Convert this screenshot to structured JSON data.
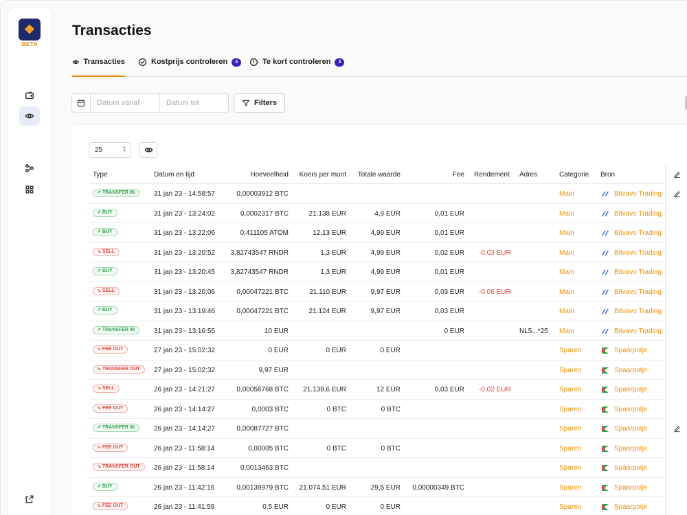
{
  "sidebar": {
    "logo_icon": "lion-logo-icon",
    "beta_label": "BETA",
    "items": [
      "wallet-icon",
      "transactions-eye-icon",
      "nodes-icon",
      "grid-icon",
      "external-link-icon"
    ]
  },
  "page": {
    "title": "Transacties"
  },
  "tabs": [
    {
      "label": "Transacties",
      "icon": "eye-transfer-icon",
      "badge": ""
    },
    {
      "label": "Kostprijs controleren",
      "icon": "check-circle-icon",
      "badge": "4"
    },
    {
      "label": "Te kort controleren",
      "icon": "alert-circle-icon",
      "badge": "3"
    }
  ],
  "filters": {
    "date_from_placeholder": "Datum vanaf",
    "date_to_placeholder": "Datum tot",
    "filters_label": "Filters"
  },
  "table": {
    "page_size": "25",
    "columns": [
      "Type",
      "Datum en tijd",
      "Hoeveelheid",
      "Koers per munt",
      "Totale waarde",
      "Fee",
      "Rendement",
      "Adres",
      "Categorie",
      "Bron"
    ],
    "rows": [
      {
        "type": "TRANSFER IN",
        "dir": "in",
        "date": "31 jan 23 - 14:58:57",
        "qty": "0,00003912 BTC",
        "rate": "",
        "total": "",
        "fee": "",
        "rend": "",
        "addr": "",
        "cat": "Main",
        "src": "Bitvavo Trading",
        "edit": true
      },
      {
        "type": "BUY",
        "dir": "in",
        "date": "31 jan 23 - 13:24:02",
        "qty": "0,0002317 BTC",
        "rate": "21.138 EUR",
        "total": "4,9 EUR",
        "fee": "0,01 EUR",
        "rend": "",
        "addr": "",
        "cat": "Main",
        "src": "Bitvavo Trading",
        "edit": false
      },
      {
        "type": "BUY",
        "dir": "in",
        "date": "31 jan 23 - 13:22:06",
        "qty": "0,411105 ATOM",
        "rate": "12,13 EUR",
        "total": "4,99 EUR",
        "fee": "0,01 EUR",
        "rend": "",
        "addr": "",
        "cat": "Main",
        "src": "Bitvavo Trading",
        "edit": false
      },
      {
        "type": "SELL",
        "dir": "out",
        "date": "31 jan 23 - 13:20:52",
        "qty": "3,82743547 RNDR",
        "rate": "1,3 EUR",
        "total": "4,99 EUR",
        "fee": "0,02 EUR",
        "rend": "-0,03 EUR",
        "addr": "",
        "cat": "Main",
        "src": "Bitvavo Trading",
        "edit": false
      },
      {
        "type": "BUY",
        "dir": "in",
        "date": "31 jan 23 - 13:20:45",
        "qty": "3,82743547 RNDR",
        "rate": "1,3 EUR",
        "total": "4,99 EUR",
        "fee": "0,01 EUR",
        "rend": "",
        "addr": "",
        "cat": "Main",
        "src": "Bitvavo Trading",
        "edit": false
      },
      {
        "type": "SELL",
        "dir": "out",
        "date": "31 jan 23 - 13:20:06",
        "qty": "0,00047221 BTC",
        "rate": "21.110 EUR",
        "total": "9,97 EUR",
        "fee": "0,03 EUR",
        "rend": "-0,06 EUR",
        "addr": "",
        "cat": "Main",
        "src": "Bitvavo Trading",
        "edit": false
      },
      {
        "type": "BUY",
        "dir": "in",
        "date": "31 jan 23 - 13:19:46",
        "qty": "0,00047221 BTC",
        "rate": "21.124 EUR",
        "total": "9,97 EUR",
        "fee": "0,03 EUR",
        "rend": "",
        "addr": "",
        "cat": "Main",
        "src": "Bitvavo Trading",
        "edit": false
      },
      {
        "type": "TRANSFER IN",
        "dir": "in",
        "date": "31 jan 23 - 13:16:55",
        "qty": "10 EUR",
        "rate": "",
        "total": "",
        "fee": "0 EUR",
        "rend": "",
        "addr": "NL5...*25",
        "cat": "Main",
        "src": "Bitvavo Trading",
        "edit": false
      },
      {
        "type": "FEE OUT",
        "dir": "out",
        "date": "27 jan 23 - 15:02:32",
        "qty": "0 EUR",
        "rate": "0 EUR",
        "total": "0 EUR",
        "fee": "",
        "rend": "",
        "addr": "",
        "cat": "Sparen",
        "src": "Spaarpotje",
        "edit": false
      },
      {
        "type": "TRANSFER OUT",
        "dir": "out",
        "date": "27 jan 23 - 15:02:32",
        "qty": "9,97 EUR",
        "rate": "",
        "total": "",
        "fee": "",
        "rend": "",
        "addr": "",
        "cat": "Sparen",
        "src": "Spaarpotje",
        "edit": false
      },
      {
        "type": "SELL",
        "dir": "out",
        "date": "26 jan 23 - 14:21:27",
        "qty": "0,00056768 BTC",
        "rate": "21.138,6 EUR",
        "total": "12 EUR",
        "fee": "0,03 EUR",
        "rend": "-0,02 EUR",
        "addr": "",
        "cat": "Sparen",
        "src": "Spaarpotje",
        "edit": false
      },
      {
        "type": "FEE OUT",
        "dir": "out",
        "date": "26 jan 23 - 14:14:27",
        "qty": "0,0003 BTC",
        "rate": "0 BTC",
        "total": "0 BTC",
        "fee": "",
        "rend": "",
        "addr": "",
        "cat": "Sparen",
        "src": "Spaarpotje",
        "edit": false
      },
      {
        "type": "TRANSFER IN",
        "dir": "in",
        "date": "26 jan 23 - 14:14:27",
        "qty": "0,00087727 BTC",
        "rate": "",
        "total": "",
        "fee": "",
        "rend": "",
        "addr": "",
        "cat": "Sparen",
        "src": "Spaarpotje",
        "edit": true
      },
      {
        "type": "FEE OUT",
        "dir": "out",
        "date": "26 jan 23 - 11:58:14",
        "qty": "0,00005 BTC",
        "rate": "0 BTC",
        "total": "0 BTC",
        "fee": "",
        "rend": "",
        "addr": "",
        "cat": "Sparen",
        "src": "Spaarpotje",
        "edit": false
      },
      {
        "type": "TRANSFER OUT",
        "dir": "out",
        "date": "26 jan 23 - 11:58:14",
        "qty": "0,0013463 BTC",
        "rate": "",
        "total": "",
        "fee": "",
        "rend": "",
        "addr": "",
        "cat": "Sparen",
        "src": "Spaarpotje",
        "edit": false
      },
      {
        "type": "BUY",
        "dir": "in",
        "date": "26 jan 23 - 11:42:16",
        "qty": "0,00139979 BTC",
        "rate": "21.074,51 EUR",
        "total": "29,5 EUR",
        "fee": "0,00000349 BTC",
        "rend": "",
        "addr": "",
        "cat": "Sparen",
        "src": "Spaarpotje",
        "edit": false
      },
      {
        "type": "FEE OUT",
        "dir": "out",
        "date": "26 jan 23 - 11:41:59",
        "qty": "0,5 EUR",
        "rate": "0 EUR",
        "total": "0 EUR",
        "fee": "",
        "rend": "",
        "addr": "",
        "cat": "Sparen",
        "src": "Spaarpotje",
        "edit": false
      }
    ]
  }
}
